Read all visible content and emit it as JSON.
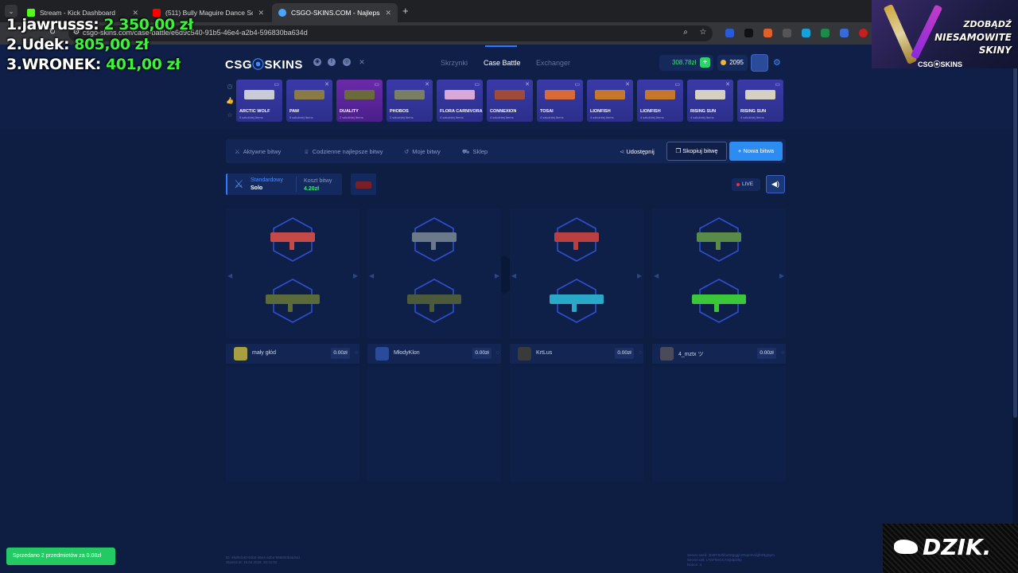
{
  "browser": {
    "tabs": [
      {
        "title": "Stream - Kick Dashboard",
        "favicon_color": "#53fc18"
      },
      {
        "title": "(511) Bully Maguire Dance Sce",
        "favicon_color": "#ff0000"
      },
      {
        "title": "CSGO-SKINS.COM - Najlepsze",
        "favicon_color": "#4aa3ff"
      }
    ],
    "url": "csgo-skins.com/case-battle/e6d9c540-91b5-46e4-a2b4-596830ba634d"
  },
  "overlay": {
    "leaderboard": [
      {
        "rank": "1.",
        "name": "jawrusss:",
        "amount": "2 350,00 zł"
      },
      {
        "rank": "2.",
        "name": "Udek:",
        "amount": "805,00 zł"
      },
      {
        "rank": "3.",
        "name": "WRONEK:",
        "amount": "401,00 zł"
      }
    ],
    "promo": {
      "line1": "ZDOBĄDŹ",
      "line2": "NIESAMOWITE",
      "line3": "SKINY",
      "brand": "CSG⦿SKINS"
    },
    "dzik": "DZIK."
  },
  "site": {
    "logo_a": "CSG",
    "logo_o": "⦿",
    "logo_b": "SKINS",
    "nav": [
      "Skrzynki",
      "Case Battle",
      "Exchanger"
    ],
    "balance": "308.78zł",
    "coins": "2095",
    "cases": [
      {
        "name": "ARCTIC WOLF",
        "count": "5 szkolniej Items",
        "color": "#c9ccd6"
      },
      {
        "name": "PAW",
        "count": "5 szkolniej Items",
        "color": "#8a7a46"
      },
      {
        "name": "DUALITY",
        "count": "2 szkolniej Items",
        "color": "#6a6a3a"
      },
      {
        "name": "PHOBOS",
        "count": "2 szkolniej Items",
        "color": "#7a7f64"
      },
      {
        "name": "FLORA CARNIVORA",
        "count": "4 szkolniej Items",
        "color": "#d7a8d8"
      },
      {
        "name": "CONNEXION",
        "count": "4 szkolniej Items",
        "color": "#a04a3a"
      },
      {
        "name": "TOSAI",
        "count": "4 szkolniej Items",
        "color": "#d86a38"
      },
      {
        "name": "LIONFISH",
        "count": "4 szkolniej Items",
        "color": "#c5782a"
      },
      {
        "name": "LIONFISH",
        "count": "4 szkolniej Items",
        "color": "#c5782a"
      },
      {
        "name": "RISING SUN",
        "count": "4 szkolniej Items",
        "color": "#d6d0c0"
      },
      {
        "name": "RISING SUN",
        "count": "4 szkolniej Items",
        "color": "#d6d0c0"
      }
    ],
    "battle_tabs": [
      "Aktywne bitwy",
      "Codzienne najlepsze bitwy",
      "Moje bitwy",
      "Sklep"
    ],
    "share": "Udostępnij",
    "copy": "Skopiuj bitwę",
    "new": "+ Nowa bitwa",
    "mode_type": "Standardowy",
    "mode_size": "Solo",
    "cost_label": "Koszt bitwy",
    "cost": "4.20zł",
    "live": "LIVE",
    "players": [
      {
        "name": "mały głód",
        "value": "0.00zł",
        "avatar": "#a8a040",
        "w1": "#c44a4a",
        "w2": "#5a6a3a"
      },
      {
        "name": "MłodyKlon",
        "value": "0.00zł",
        "avatar": "#2a4a9a",
        "w1": "#6a7a8a",
        "w2": "#4a5a3a"
      },
      {
        "name": "KrtLus",
        "value": "0.00zł",
        "avatar": "#3a3a3a",
        "w1": "#b84040",
        "w2": "#2aa8c8"
      },
      {
        "name": "4_mztx ツ",
        "value": "0.00zł",
        "avatar": "#4a4a5a",
        "w1": "#5a8a4a",
        "w2": "#3ac83a"
      }
    ],
    "footer_left": [
      "ID: e6d9c540-91b5-46e4-a2b4-596830ba634d",
      "Started at: 16.04.2025, 20:31:52"
    ],
    "footer_right": [
      "Server seed: 2b0Pr92bbo0Sgqgjc2Rqm5Vdgh0NgSym",
      "Secret salt: LTGFf0rGC74QdpDhp",
      "Nonce: 4"
    ],
    "toast": "Sprzedano 2 przedmiotów za 0.08zł"
  }
}
